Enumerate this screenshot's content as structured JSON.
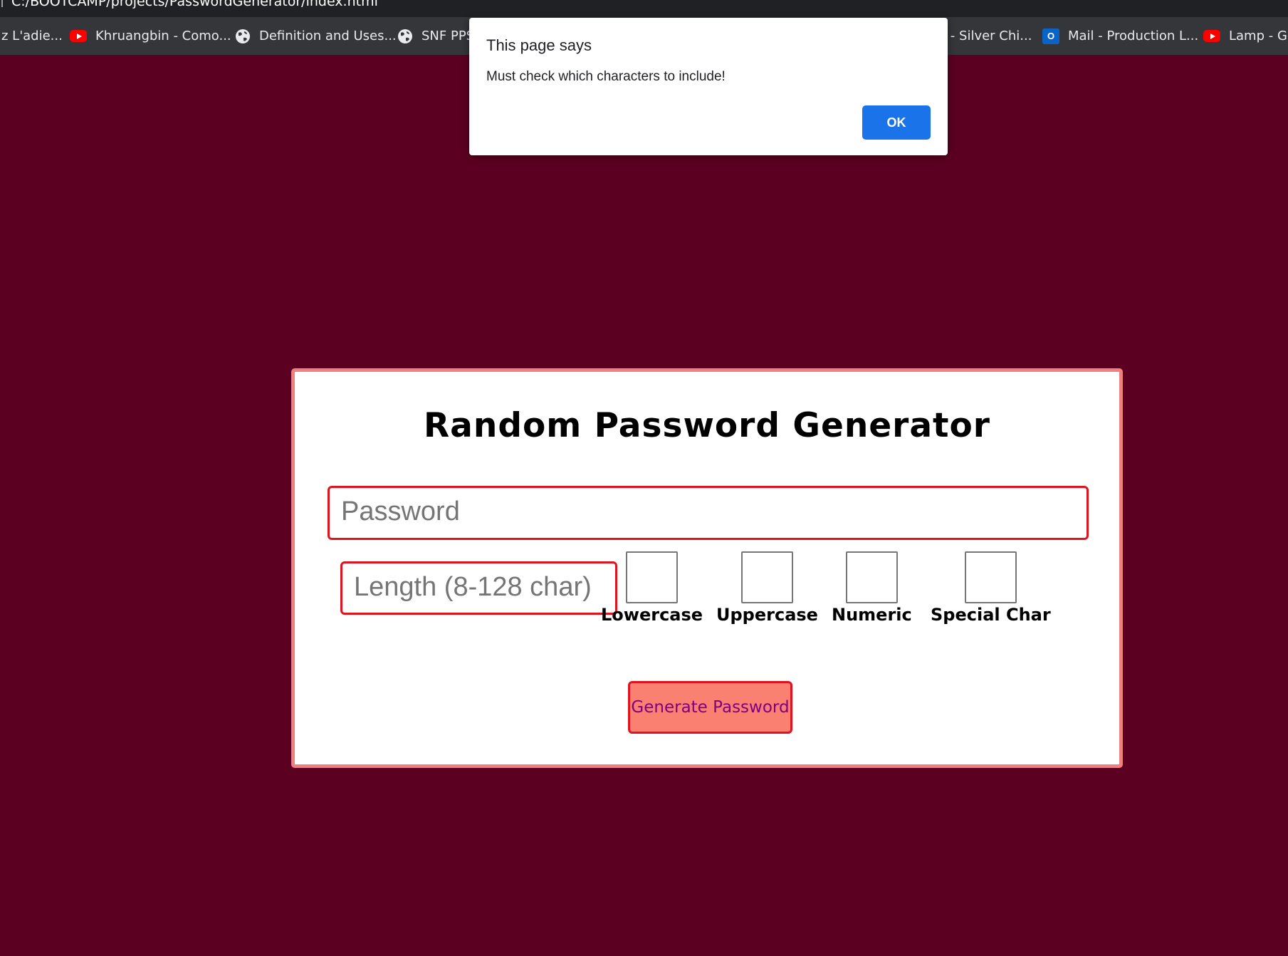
{
  "browser": {
    "url": "C:/BOOTCAMP/projects/PasswordGenerator/index.html",
    "bookmarks": [
      {
        "label": "z L'adie...",
        "icon": "none"
      },
      {
        "label": "Khruangbin - Como...",
        "icon": "youtube-icon"
      },
      {
        "label": "Definition and Uses...",
        "icon": "globe-icon"
      },
      {
        "label": "SNF PPS",
        "icon": "globe-icon"
      },
      {
        "label": "e - Silver Chi...",
        "icon": "none"
      },
      {
        "label": "Mail - Production L...",
        "icon": "outlook-icon"
      },
      {
        "label": "Lamp - Ge",
        "icon": "youtube-icon"
      }
    ]
  },
  "alert": {
    "title": "This page says",
    "message": "Must check which characters to include!",
    "ok_label": "OK"
  },
  "app": {
    "title": "Random Password Generator",
    "password_placeholder": "Password",
    "length_placeholder": "Length (8-128 char)",
    "options": [
      {
        "label": "Lowercase",
        "checked": false
      },
      {
        "label": "Uppercase",
        "checked": false
      },
      {
        "label": "Numeric",
        "checked": false
      },
      {
        "label": "Special Char",
        "checked": false
      }
    ],
    "generate_label": "Generate Password"
  },
  "colors": {
    "page_background": "#5b0020",
    "card_border": "#f08080",
    "field_border": "#e0141e",
    "button_fill": "#fa8072",
    "button_text": "#800080",
    "alert_ok": "#1a73e8"
  }
}
